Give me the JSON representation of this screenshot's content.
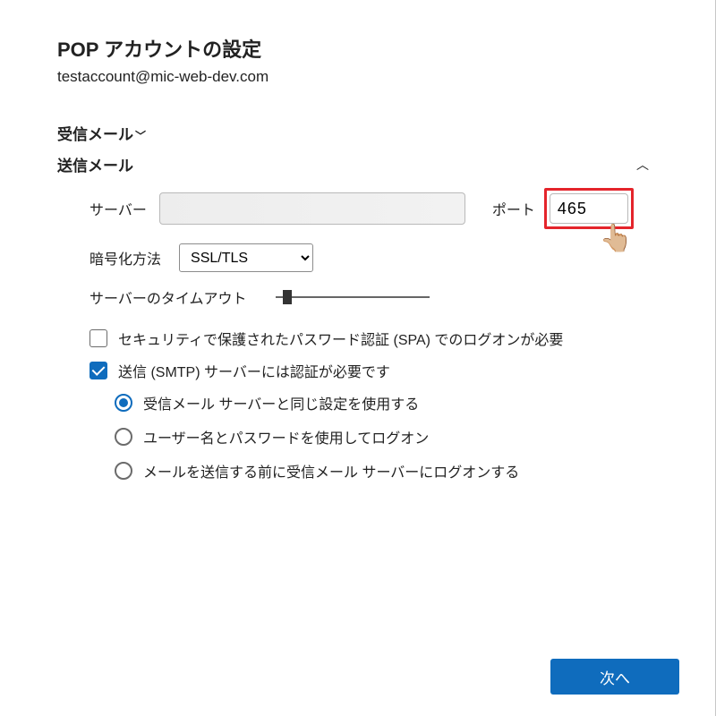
{
  "title": "POP アカウントの設定",
  "email": "testaccount@mic-web-dev.com",
  "incoming_section": {
    "label": "受信メール"
  },
  "outgoing_section": {
    "label": "送信メール"
  },
  "labels": {
    "server": "サーバー",
    "port": "ポート",
    "encryption": "暗号化方法",
    "timeout": "サーバーのタイムアウト"
  },
  "fields": {
    "server": "",
    "port": "465",
    "encryption_selected": "SSL/TLS",
    "encryption_options": [
      "SSL/TLS"
    ]
  },
  "checkboxes": {
    "spa": {
      "checked": false,
      "label": "セキュリティで保護されたパスワード認証 (SPA) でのログオンが必要"
    },
    "smtp_auth": {
      "checked": true,
      "label": "送信 (SMTP) サーバーには認証が必要です"
    }
  },
  "smtp_auth_options": [
    {
      "selected": true,
      "label": "受信メール サーバーと同じ設定を使用する"
    },
    {
      "selected": false,
      "label": "ユーザー名とパスワードを使用してログオン"
    },
    {
      "selected": false,
      "label": "メールを送信する前に受信メール サーバーにログオンする"
    }
  ],
  "buttons": {
    "next": "次へ"
  }
}
